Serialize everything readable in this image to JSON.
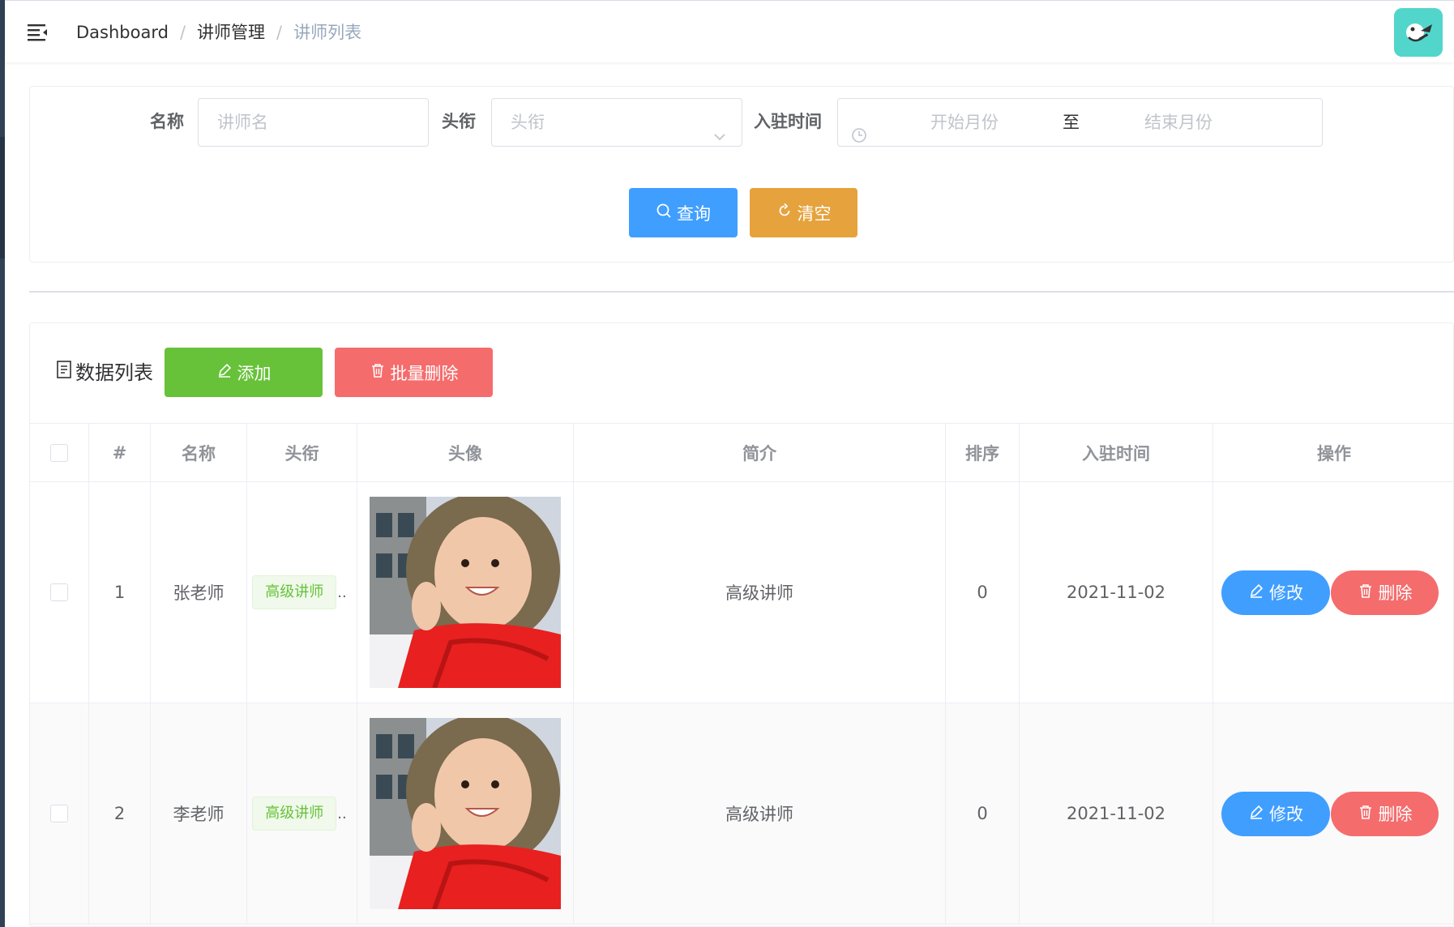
{
  "breadcrumb": [
    "Dashboard",
    "讲师管理",
    "讲师列表"
  ],
  "search": {
    "name_label": "名称",
    "name_placeholder": "讲师名",
    "title_label": "头衔",
    "title_placeholder": "头衔",
    "time_label": "入驻时间",
    "start_placeholder": "开始月份",
    "range_separator": "至",
    "end_placeholder": "结束月份",
    "query_label": "查询",
    "clear_label": "清空"
  },
  "list": {
    "title": "数据列表",
    "add_label": "添加",
    "batch_delete_label": "批量删除"
  },
  "table": {
    "columns": [
      "#",
      "名称",
      "头衔",
      "头像",
      "简介",
      "排序",
      "入驻时间",
      "操作"
    ],
    "rows": [
      {
        "index": "1",
        "name": "张老师",
        "title_tag": "高级讲师",
        "intro": "高级讲师",
        "sort": "0",
        "joined": "2021-11-02"
      },
      {
        "index": "2",
        "name": "李老师",
        "title_tag": "高级讲师",
        "intro": "高级讲师",
        "sort": "0",
        "joined": "2021-11-02"
      }
    ],
    "edit_label": "修改",
    "delete_label": "删除",
    "ellipsis": ".."
  },
  "colors": {
    "primary": "#409eff",
    "warning": "#e6a23c",
    "success": "#67c23a",
    "danger": "#f56c6c"
  }
}
